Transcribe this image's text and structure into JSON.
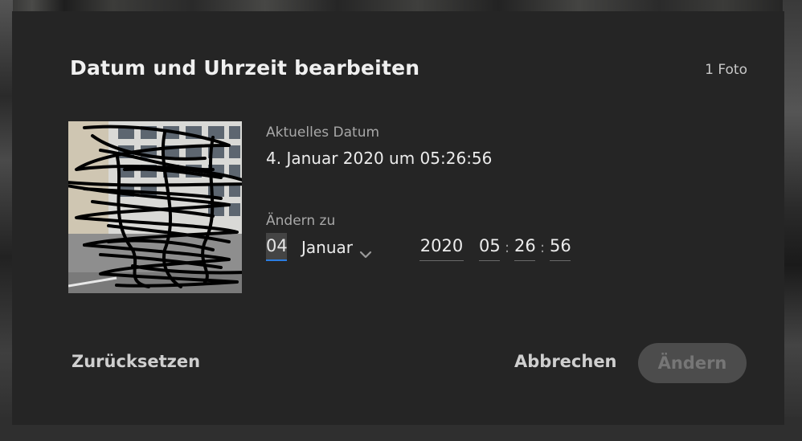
{
  "dialog": {
    "title": "Datum und Uhrzeit bearbeiten",
    "photo_count": "1 Foto"
  },
  "current": {
    "label": "Aktuelles Datum",
    "value": "4. Januar 2020 um 05:26:56"
  },
  "change": {
    "label": "Ändern zu",
    "day": "04",
    "month": "Januar",
    "year": "2020",
    "hour": "05",
    "minute": "26",
    "second": "56",
    "separator": ":"
  },
  "buttons": {
    "reset": "Zurücksetzen",
    "cancel": "Abbrechen",
    "apply": "Ändern"
  },
  "icons": {
    "month_dropdown": "chevron-down-icon"
  },
  "colors": {
    "dialog_bg": "#252525",
    "focus_underline": "#2b7de1",
    "disabled_button_bg": "#4c4c4c"
  }
}
